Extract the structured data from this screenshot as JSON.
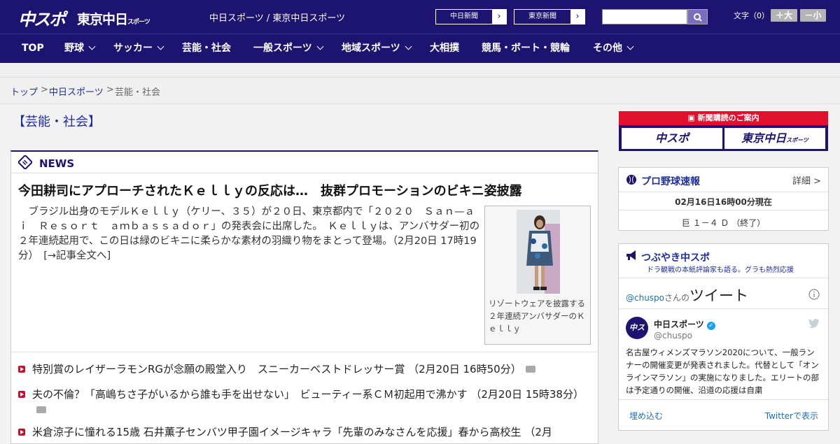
{
  "header": {
    "logo_chuspo": "中スポ",
    "logo_tokyo": "東京中日",
    "logo_tokyo_small": "スポーツ",
    "site_title": "中日スポーツ / 東京中日スポーツ",
    "newspaper_links": [
      {
        "label": "中日新聞",
        "arrow": "›"
      },
      {
        "label": "東京新聞",
        "arrow": "›"
      }
    ],
    "search_placeholder": "",
    "text_size_label": "文字（0）",
    "text_size_larger": "＋大",
    "text_size_smaller": "－小"
  },
  "nav": {
    "items": [
      {
        "label": "TOP",
        "dropdown": false
      },
      {
        "label": "野球",
        "dropdown": true
      },
      {
        "label": "サッカー",
        "dropdown": true
      },
      {
        "label": "芸能・社会",
        "dropdown": false
      },
      {
        "label": "一般スポーツ",
        "dropdown": true
      },
      {
        "label": "地域スポーツ",
        "dropdown": true
      },
      {
        "label": "大相撲",
        "dropdown": false
      },
      {
        "label": "競馬・ボート・競輪",
        "dropdown": false
      },
      {
        "label": "その他",
        "dropdown": true
      }
    ]
  },
  "breadcrumb": {
    "items": [
      "トップ",
      "中日スポーツ",
      "芸能・社会"
    ],
    "separator": ">"
  },
  "main": {
    "section_title": "【芸能・社会】",
    "news_label": "NEWS",
    "top_story": {
      "headline": "今田耕司にアプローチされたＫｅｌｌｙの反応は…　抜群プロモーションのビキニ姿披露",
      "lead": "　ブラジル出身のモデルＫｅｌｌｙ（ケリー、３５）が２０日、東京都内で「２０２０　Ｓａｎ—ａｉ　Ｒｅｓｏｒｔ　ａｍｂａｓｓａｄｏｒ」の発表会に出席した。　Ｋｅｌｌｙは、アンバサダー初の２年連続起用で、この日は緑のビキニに柔らかな素材の羽織り物をまとって登場。（2月20日 17時19分）　[→記事全文へ]",
      "photo_caption": "リゾートウェアを披露する２年連続アンバサダーのＫｅｌｌｙ"
    },
    "items": [
      {
        "text": "特別賞のレイザーラモンRGが念願の殿堂入り　スニーカーベストドレッサー賞 （2月20日 16時50分）",
        "camera": true
      },
      {
        "text": "夫の不倫？「高嶋ちさ子がいるから誰も手を出せない」　ビューティー系ＣＭ初起用で沸かす （2月20日 15時38分）",
        "camera": true
      },
      {
        "text": "米倉涼子に憧れる15歳 石井薫子センバツ甲子園イメージキャラ「先輩のみなさんを応援」春から高校生 （2月",
        "camera": false
      }
    ]
  },
  "sidebar": {
    "subscribe": {
      "title": "新聞購読のご案内",
      "btn1": "中スポ",
      "btn2": "東京中日",
      "btn2_small": "スポーツ"
    },
    "baseball": {
      "title": "プロ野球速報",
      "detail": "詳細 >",
      "timestamp": "02月16日16時00分現在",
      "score": "巨 １－４ Ｄ （終了）"
    },
    "tweets": {
      "title": "つぶやき中スポ",
      "subtitle": "ドラ観戦の本紙評論家も語る。グラも熱烈応援",
      "handle_prefix": "@chuspo",
      "handle_suffix": "さんの",
      "tweets_word": "ツイート",
      "account_name": "中日スポーツ",
      "account_handle": "@chuspo",
      "tweet_text": "名古屋ウィメンズマラソン2020について、一般ランナーの開催変更が発表されました。代替として「オンラインマラソン」の実施になりました。エリートの部は予定通りの開催、沿道の応援は自粛",
      "embed": "埋め込む",
      "view_on_twitter": "Twitterで表示"
    }
  },
  "colors": {
    "navy": "#1c1470",
    "link_blue": "#1c2ea0",
    "red": "#e0102e"
  }
}
